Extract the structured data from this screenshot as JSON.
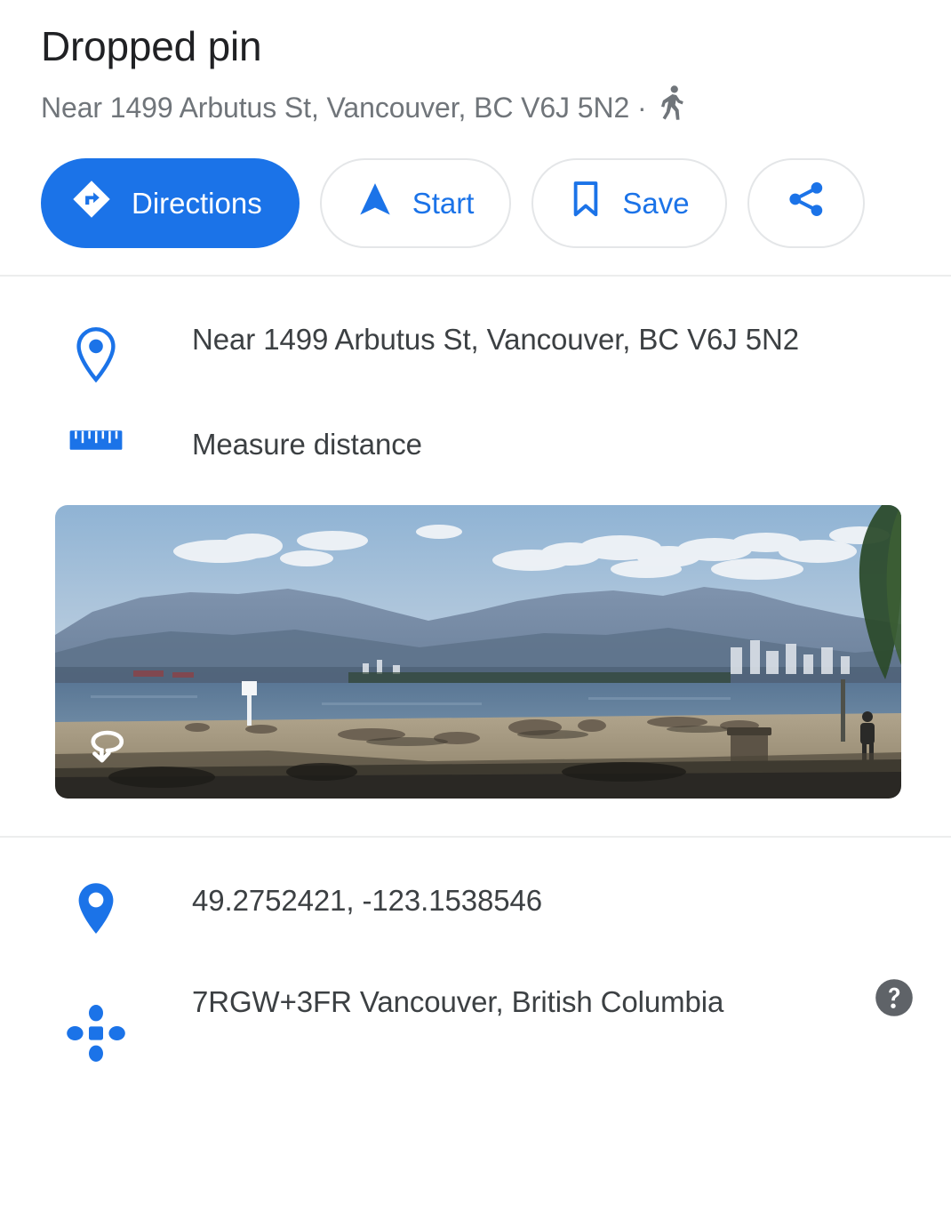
{
  "header": {
    "title": "Dropped pin",
    "subtitle": "Near 1499 Arbutus St, Vancouver, BC V6J 5N2 ·",
    "travel_mode_icon": "walking-person-icon"
  },
  "actions": [
    {
      "label": "Directions",
      "icon": "directions-diamond-icon",
      "style": "primary"
    },
    {
      "label": "Start",
      "icon": "navigation-arrow-icon",
      "style": "outline"
    },
    {
      "label": "Save",
      "icon": "bookmark-icon",
      "style": "outline"
    },
    {
      "label": "",
      "icon": "share-icon",
      "style": "icon-only"
    }
  ],
  "details": {
    "address": {
      "text": "Near 1499 Arbutus St, Vancouver, BC V6J 5N2",
      "icon": "map-pin-outline-icon"
    },
    "measure": {
      "text": "Measure distance",
      "icon": "ruler-icon"
    },
    "coordinates": {
      "text": "49.2752421, -123.1538546",
      "icon": "map-pin-filled-icon"
    },
    "plus_code": {
      "text": "7RGW+3FR Vancouver, British Columbia",
      "icon": "plus-code-icon",
      "help_icon": "help-question-icon"
    }
  },
  "photo": {
    "description": "Street View panorama of beach with mountains and city skyline",
    "pano_icon": "pano-rotate-icon"
  },
  "colors": {
    "accent_blue": "#1b73e8",
    "text_primary": "#202124",
    "text_secondary": "#70757a",
    "text_body": "#3c4043",
    "divider": "#eceded",
    "help_gray": "#5f6368"
  }
}
